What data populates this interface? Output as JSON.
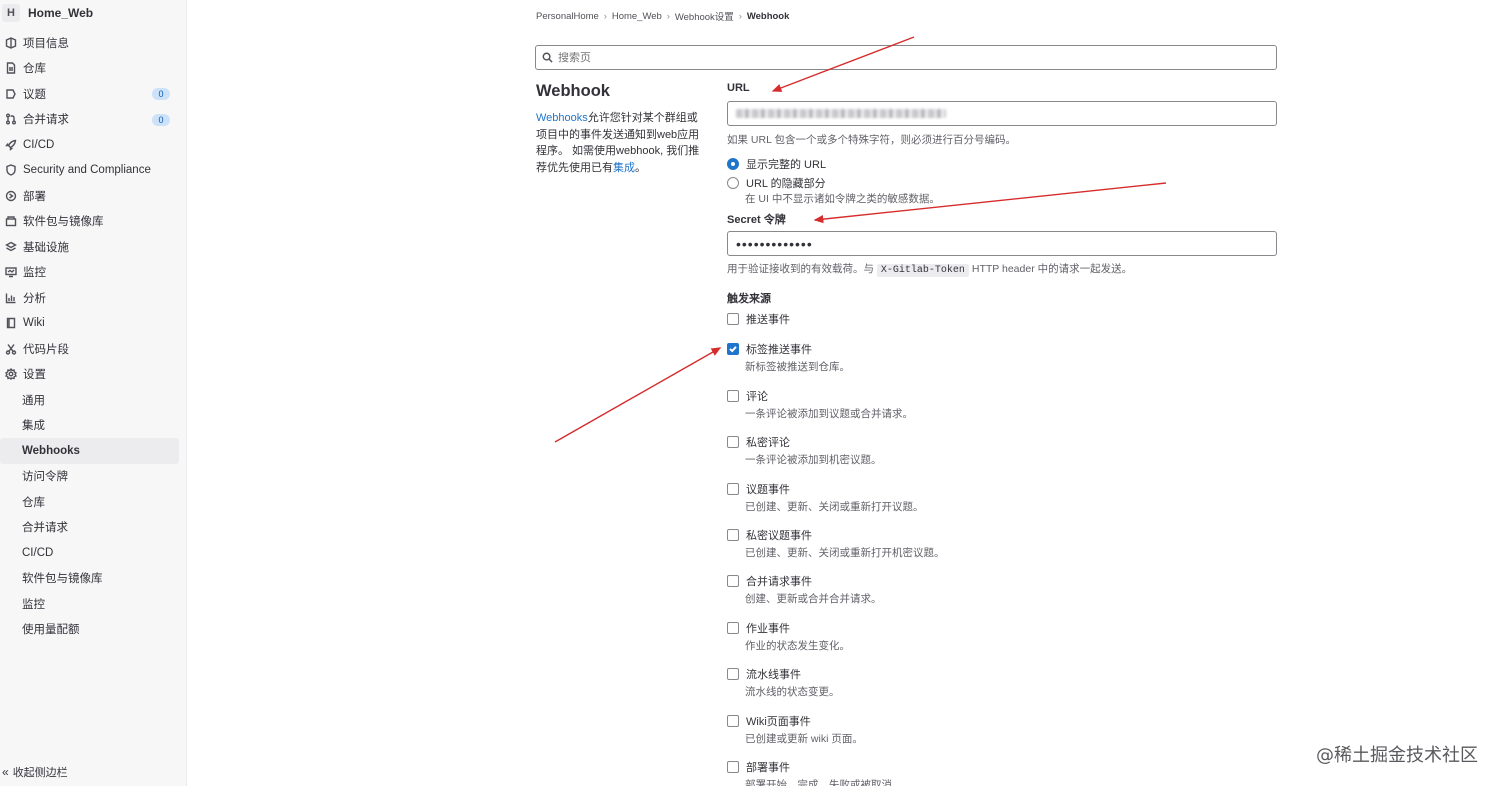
{
  "sidebar": {
    "project": {
      "avatar": "H",
      "name": "Home_Web"
    },
    "items": [
      {
        "label": "项目信息",
        "icon": "project-info-icon"
      },
      {
        "label": "仓库",
        "icon": "file-icon"
      },
      {
        "label": "议题",
        "icon": "issues-icon",
        "badge": "0"
      },
      {
        "label": "合并请求",
        "icon": "merge-request-icon",
        "badge": "0"
      },
      {
        "label": "CI/CD",
        "icon": "rocket-icon"
      },
      {
        "label": "Security and Compliance",
        "icon": "shield-icon"
      },
      {
        "label": "部署",
        "icon": "deployments-icon"
      },
      {
        "label": "软件包与镜像库",
        "icon": "package-icon"
      },
      {
        "label": "基础设施",
        "icon": "cloud-icon"
      },
      {
        "label": "监控",
        "icon": "monitor-icon"
      },
      {
        "label": "分析",
        "icon": "chart-icon"
      },
      {
        "label": "Wiki",
        "icon": "book-icon"
      },
      {
        "label": "代码片段",
        "icon": "snippet-icon"
      },
      {
        "label": "设置",
        "icon": "gear-icon"
      }
    ],
    "settings_sub": [
      "通用",
      "集成",
      "Webhooks",
      "访问令牌",
      "仓库",
      "合并请求",
      "CI/CD",
      "软件包与镜像库",
      "监控",
      "使用量配额"
    ],
    "active_sub": "Webhooks",
    "collapse_label": "收起侧边栏"
  },
  "breadcrumb": [
    "PersonalHome",
    "Home_Web",
    "Webhook设置",
    "Webhook"
  ],
  "search": {
    "placeholder": "搜索页"
  },
  "intro": {
    "title": "Webhook",
    "link_text": "Webhooks",
    "text1": "允许您针对某个群组或项目中的事件发送通知到web应用程序。 如需使用webhook, 我们推荐优先使用已有",
    "link2": "集成",
    "text2": "。"
  },
  "form": {
    "url_label": "URL",
    "url_help": "如果 URL 包含一个或多个特殊字符，则必须进行百分号编码。",
    "radio_full": "显示完整的 URL",
    "radio_mask": "URL 的隐藏部分",
    "radio_mask_help": "在 UI 中不显示诸如令牌之类的敏感数据。",
    "secret_label": "Secret 令牌",
    "secret_value": "•••••••••••••",
    "secret_help_pre": "用于验证接收到的有效载荷。与",
    "secret_help_code": "X-Gitlab-Token",
    "secret_help_post": "HTTP header 中的请求一起发送。",
    "triggers_label": "触发来源",
    "triggers": [
      {
        "label": "推送事件",
        "desc": "",
        "checked": false
      },
      {
        "label": "标签推送事件",
        "desc": "新标签被推送到仓库。",
        "checked": true
      },
      {
        "label": "评论",
        "desc": "一条评论被添加到议题或合并请求。",
        "checked": false
      },
      {
        "label": "私密评论",
        "desc": "一条评论被添加到机密议题。",
        "checked": false
      },
      {
        "label": "议题事件",
        "desc": "已创建、更新、关闭或重新打开议题。",
        "checked": false
      },
      {
        "label": "私密议题事件",
        "desc": "已创建、更新、关闭或重新打开机密议题。",
        "checked": false
      },
      {
        "label": "合并请求事件",
        "desc": "创建、更新或合并合并请求。",
        "checked": false
      },
      {
        "label": "作业事件",
        "desc": "作业的状态发生变化。",
        "checked": false
      },
      {
        "label": "流水线事件",
        "desc": "流水线的状态变更。",
        "checked": false
      },
      {
        "label": "Wiki页面事件",
        "desc": "已创建或更新 wiki 页面。",
        "checked": false
      },
      {
        "label": "部署事件",
        "desc": "部署开始、完成、失败或被取消。",
        "checked": false
      }
    ]
  },
  "watermark": "@稀土掘金技术社区",
  "colors": {
    "accent": "#1f75cb",
    "arrow": "#d62c2c",
    "sidebar_bg": "#f7f7f8"
  }
}
